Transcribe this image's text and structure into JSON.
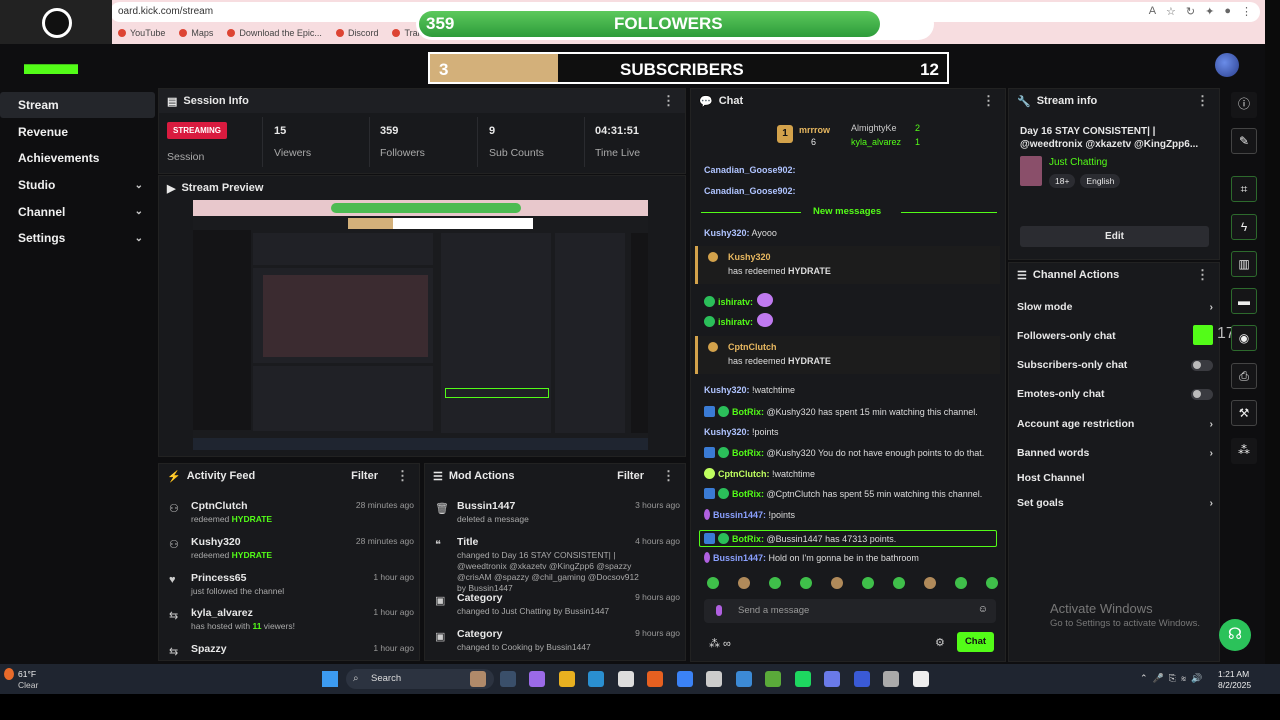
{
  "browser": {
    "url": "oard.kick.com/stream",
    "bookmarks": [
      "YouTube",
      "Maps",
      "Download the Epic...",
      "Discord",
      "Translate"
    ]
  },
  "goals": {
    "followers": {
      "current": "359",
      "label": "FOLLOWERS",
      "target": "400",
      "progress": 0.9
    },
    "subscribers": {
      "current": "3",
      "label": "SUBSCRIBERS",
      "target": "12",
      "progress": 0.25
    }
  },
  "sidebar": {
    "items": [
      {
        "label": "Stream",
        "expand": false
      },
      {
        "label": "Revenue",
        "expand": false
      },
      {
        "label": "Achievements",
        "expand": false
      },
      {
        "label": "Studio",
        "expand": true
      },
      {
        "label": "Channel",
        "expand": true
      },
      {
        "label": "Settings",
        "expand": true
      }
    ]
  },
  "session_info": {
    "title": "Session Info",
    "badge": "STREAMING",
    "session_label": "Session",
    "stats": [
      {
        "value": "15",
        "label": "Viewers"
      },
      {
        "value": "359",
        "label": "Followers"
      },
      {
        "value": "9",
        "label": "Sub Counts"
      },
      {
        "value": "04:31:51",
        "label": "Time Live"
      }
    ]
  },
  "stream_preview": {
    "title": "Stream Preview"
  },
  "activity_feed": {
    "title": "Activity Feed",
    "filter": "Filter",
    "items": [
      {
        "name": "CptnClutch",
        "desc_pre": "redeemed ",
        "desc_hl": "HYDRATE",
        "desc_post": "",
        "time": "28 minutes ago"
      },
      {
        "name": "Kushy320",
        "desc_pre": "redeemed ",
        "desc_hl": "HYDRATE",
        "desc_post": "",
        "time": "28 minutes ago"
      },
      {
        "name": "Princess65",
        "desc_pre": "just followed the channel",
        "desc_hl": "",
        "desc_post": "",
        "time": "1 hour ago"
      },
      {
        "name": "kyla_alvarez",
        "desc_pre": "has hosted with ",
        "desc_hl": "11",
        "desc_post": " viewers!",
        "time": "1 hour ago"
      },
      {
        "name": "Spazzy",
        "desc_pre": "",
        "desc_hl": "",
        "desc_post": "",
        "time": "1 hour ago"
      }
    ]
  },
  "mod_actions": {
    "title": "Mod Actions",
    "filter": "Filter",
    "items": [
      {
        "name": "Bussin1447",
        "line1": "deleted a message",
        "time": "3 hours ago"
      },
      {
        "name": "Title",
        "line1": "changed to Day 16 STAY CONSISTENT| | @weedtronix @xkazetv @KingZpp6 @spazzy @crisAM @spazzy @chil_gaming @Docsov912 by Bussin1447",
        "time": "4 hours ago"
      },
      {
        "name": "Category",
        "line1": "changed to Just Chatting by Bussin1447",
        "time": "9 hours ago"
      },
      {
        "name": "Category",
        "line1": "changed to Cooking by Bussin1447",
        "time": "9 hours ago"
      }
    ]
  },
  "chat": {
    "title": "Chat",
    "leaderboard": [
      {
        "name": "mrrrow",
        "count": "6"
      },
      {
        "name": "AlmightyKe",
        "count": "2"
      },
      {
        "name": "kyla_alvarez",
        "count": "1"
      }
    ],
    "top_rank": "1",
    "new_messages": "New messages",
    "earlier": [
      "Canadian_Goose902:",
      "Canadian_Goose902:"
    ],
    "messages": [
      {
        "user": "Kushy320:",
        "text": " Ayooo"
      },
      {
        "redeem_user": "Kushy320",
        "redeem_text_pre": "has redeemed ",
        "redeem_item": "HYDRATE"
      },
      {
        "user": "ishiratv:",
        "text": ""
      },
      {
        "user": "ishiratv:",
        "text": ""
      },
      {
        "redeem_user": "CptnClutch",
        "redeem_text_pre": "has redeemed ",
        "redeem_item": "HYDRATE"
      },
      {
        "user": "Kushy320:",
        "text": " !watchtime"
      },
      {
        "user": "BotRix:",
        "text": " @Kushy320 has spent 15 min watching this channel."
      },
      {
        "user": "Kushy320:",
        "text": " !points"
      },
      {
        "user": "BotRix:",
        "text": " @Kushy320 You do not have enough points to do that."
      },
      {
        "user": "CptnClutch:",
        "text": " !watchtime"
      },
      {
        "user": "BotRix:",
        "text": " @CptnClutch has spent 55 min watching this channel."
      },
      {
        "user": "Bussin1447:",
        "text": " !points"
      },
      {
        "user": "BotRix:",
        "text": " @Bussin1447 has 47313 points."
      },
      {
        "user": "Bussin1447:",
        "text": " Hold on I'm gonna be in the bathroom"
      }
    ],
    "input_placeholder": "Send a message",
    "send_label": "Chat"
  },
  "stream_info": {
    "title": "Stream info",
    "stream_title": "Day 16 STAY CONSISTENT| | @weedtronix @xkazetv @KingZpp6...",
    "category": "Just Chatting",
    "tags": [
      "18+",
      "English"
    ],
    "edit": "Edit"
  },
  "channel_actions": {
    "title": "Channel Actions",
    "items": [
      {
        "label": "Slow mode",
        "control": "chevron"
      },
      {
        "label": "Followers-only chat",
        "control": "none"
      },
      {
        "label": "Subscribers-only chat",
        "control": "toggle"
      },
      {
        "label": "Emotes-only chat",
        "control": "toggle"
      },
      {
        "label": "Account age restriction",
        "control": "chevron"
      },
      {
        "label": "Banned words",
        "control": "chevron"
      },
      {
        "label": "Host Channel",
        "control": "none"
      },
      {
        "label": "Set goals",
        "control": "chevron"
      }
    ],
    "overlay_count": "17"
  },
  "watermark": {
    "line1": "Activate Windows",
    "line2": "Go to Settings to activate Windows."
  },
  "taskbar": {
    "weather_temp": "61°F",
    "weather_desc": "Clear",
    "search": "Search",
    "time": "1:21 AM",
    "date": "8/2/2025"
  },
  "colors": {
    "kick_green": "#53fc18",
    "streaming_red": "#d91b3f",
    "gold": "#d3b07a"
  }
}
